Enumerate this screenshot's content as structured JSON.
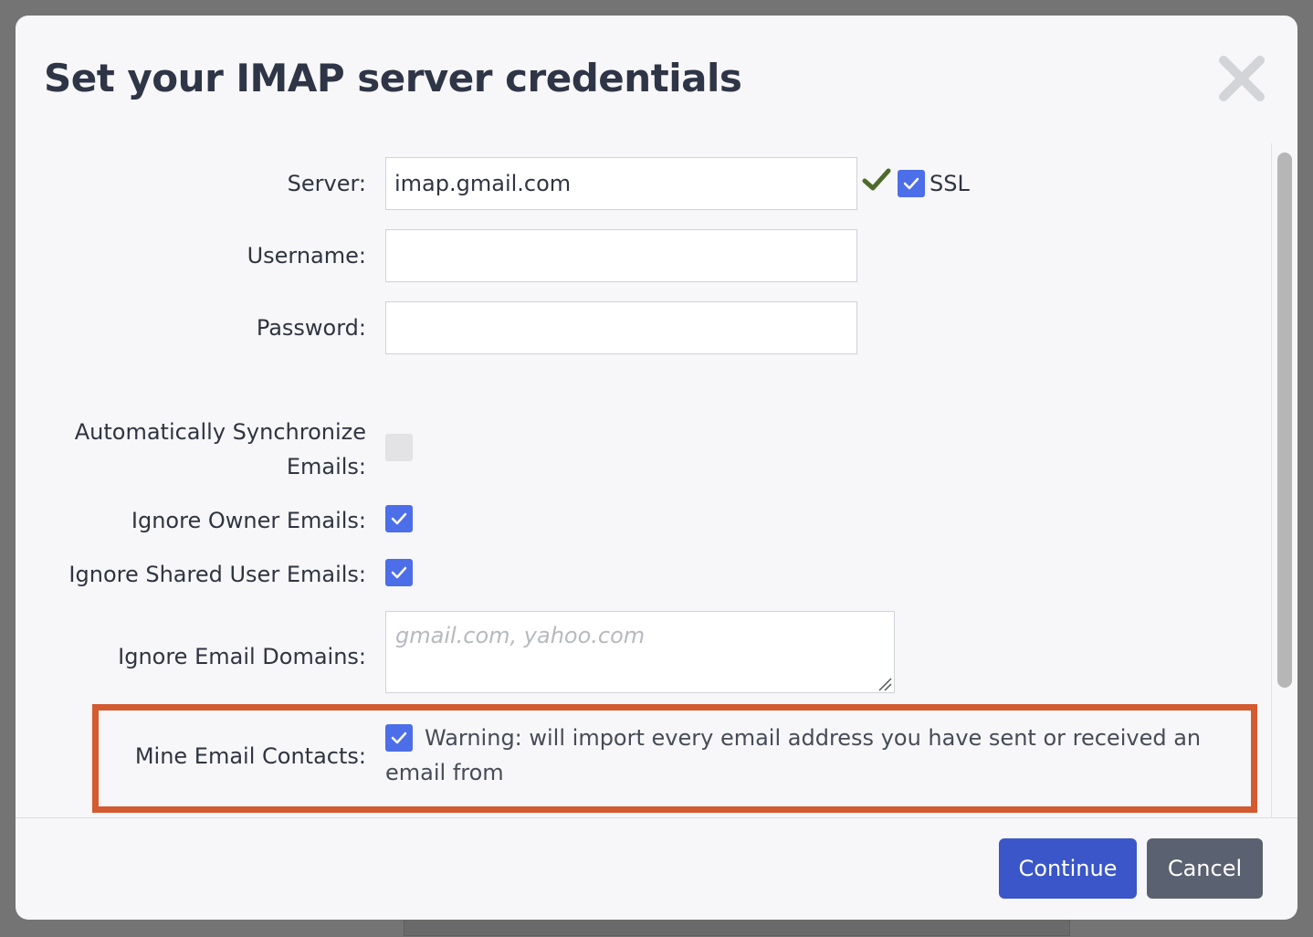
{
  "dialog": {
    "title": "Set your IMAP server credentials"
  },
  "form": {
    "server": {
      "label": "Server:",
      "value": "imap.gmail.com",
      "ssl_label": "SSL",
      "ssl_checked": true
    },
    "username": {
      "label": "Username:",
      "value": ""
    },
    "password": {
      "label": "Password:",
      "value": ""
    },
    "auto_sync": {
      "label_line1": "Automatically Synchronize",
      "label_line2": "Emails:",
      "checked": false
    },
    "ignore_owner": {
      "label": "Ignore Owner Emails:",
      "checked": true
    },
    "ignore_shared": {
      "label": "Ignore Shared User Emails:",
      "checked": true
    },
    "ignore_domains": {
      "label": "Ignore Email Domains:",
      "placeholder": "gmail.com, yahoo.com",
      "value": ""
    },
    "mine_contacts": {
      "label": "Mine Email Contacts:",
      "checked": true,
      "warning": "Warning: will import every email address you have sent or received an email from"
    }
  },
  "footer": {
    "continue_label": "Continue",
    "cancel_label": "Cancel"
  },
  "colors": {
    "primary": "#3a56c8",
    "checkbox": "#4c6ee8",
    "secondary": "#5a6170",
    "highlight": "#d45a30"
  }
}
